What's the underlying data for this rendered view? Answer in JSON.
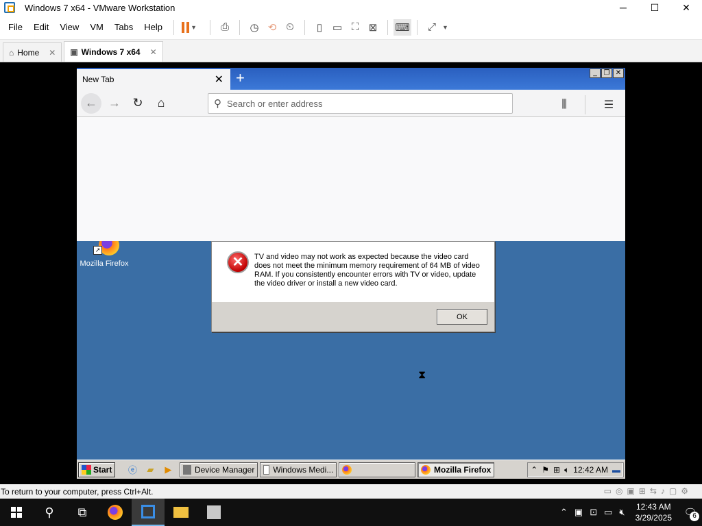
{
  "host": {
    "title": "Windows 7 x64 - VMware Workstation",
    "window_controls": {
      "minimize": "─",
      "maximize": "☐",
      "close": "✕"
    },
    "menu": [
      "File",
      "Edit",
      "View",
      "VM",
      "Tabs",
      "Help"
    ],
    "toolbar_icons": [
      "pause-icon",
      "send-keys-icon",
      "snapshot-icon",
      "revert-snapshot-icon",
      "snapshot-manager-icon",
      "library-view-icon",
      "thumbnail-bar-icon",
      "full-screen-icon",
      "unity-icon",
      "console-icon",
      "stretch-icon"
    ],
    "tabs": [
      {
        "label": "Home",
        "close": "✕"
      },
      {
        "label": "Windows 7 x64",
        "close": "✕"
      }
    ],
    "status_text": "To return to your computer, press Ctrl+Alt.",
    "accent": "#e8711c"
  },
  "guest": {
    "desktop_icon_label": "Mozilla Firefox",
    "firefox": {
      "tab_title": "New Tab",
      "tab_close": "✕",
      "new_tab": "+",
      "url_placeholder": "Search or enter address",
      "window_controls": {
        "minimize": "_",
        "restore": "❐",
        "close": "✕"
      }
    },
    "dialog": {
      "message": "TV and video may not work as expected because the video card does not meet the minimum memory requirement of 64 MB of video RAM. If you consistently encounter errors with TV or video, update the video driver or install a new video card.",
      "ok_label": "OK",
      "icon": "✕"
    },
    "taskbar": {
      "start_label": "Start",
      "tasks": [
        {
          "label": "Device Manager"
        },
        {
          "label": "Windows Medi..."
        },
        {
          "label": ""
        },
        {
          "label": "Mozilla Firefox"
        }
      ],
      "clock": "12:42 AM"
    },
    "desktop_color": "#3a6ea5"
  },
  "host_taskbar": {
    "time": "12:43 AM",
    "date": "3/29/2025",
    "notification_count": "6"
  }
}
